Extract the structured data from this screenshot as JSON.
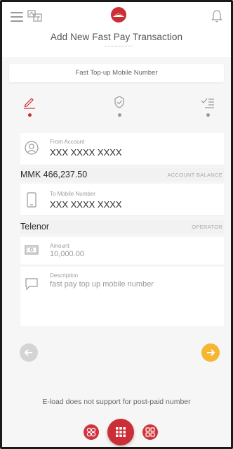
{
  "header": {
    "title": "Add New Fast Pay Transaction",
    "icons": [
      "menu-icon",
      "language-icon",
      "bank-logo",
      "bell-icon"
    ]
  },
  "subtitle": "Fast Top-up Mobile Number",
  "stepper": {
    "steps": [
      {
        "icon": "pencil-icon",
        "active": true
      },
      {
        "icon": "shield-check-icon",
        "active": false
      },
      {
        "icon": "list-check-icon",
        "active": false
      }
    ]
  },
  "form": {
    "from_account": {
      "label": "From Account",
      "value": "XXX XXXX XXXX"
    },
    "balance": {
      "value": "MMK 466,237.50",
      "label": "ACCOUNT BALANCE"
    },
    "to_mobile": {
      "label": "To Mobile Number",
      "value": "XXX XXXX XXXX"
    },
    "operator": {
      "value": "Telenor",
      "label": "OPERATOR"
    },
    "amount": {
      "label": "Amount",
      "value": "10,000.00"
    },
    "description": {
      "label": "Description",
      "value": "fast pay top up mobile number"
    }
  },
  "notice": "E-load does not support for post-paid number",
  "colors": {
    "brand_red": "#cc2e36",
    "accent_yellow": "#f5b731",
    "disabled_grey": "#d4d4d4"
  }
}
